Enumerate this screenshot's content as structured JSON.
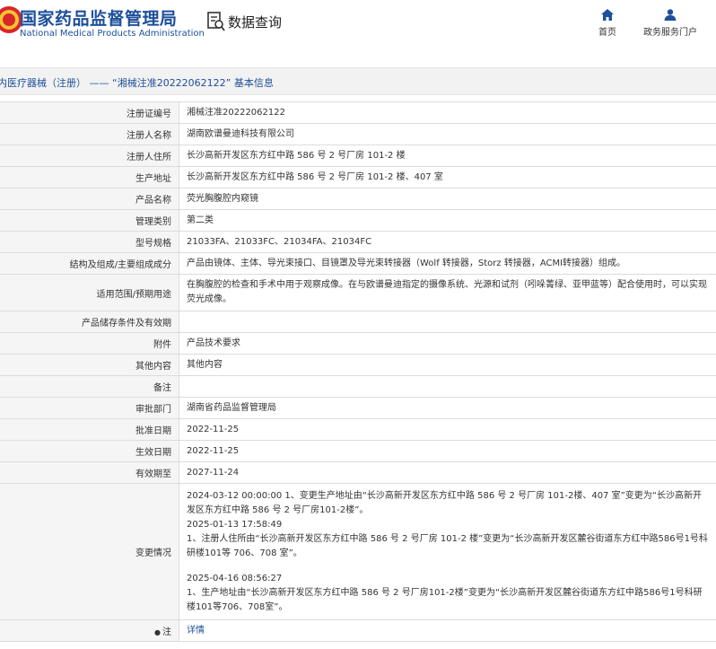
{
  "header": {
    "brand_cn": "国家药品监督管理局",
    "brand_en": "National Medical Products Administration",
    "query_title": "数据查询",
    "nav": [
      {
        "label": "首页",
        "icon": "home-icon"
      },
      {
        "label": "政务服务门户",
        "icon": "user-icon"
      }
    ]
  },
  "breadcrumb": "内医疗器械（注册） —— “湘械注准20222062122” 基本信息",
  "colors": {
    "brand": "#1d4f9b",
    "label_bg": "#f5f5f5",
    "border": "#dcdcdc"
  },
  "rows": [
    {
      "label": "注册证编号",
      "value": "湘械注准20222062122"
    },
    {
      "label": "注册人名称",
      "value": "湖南欧谱曼迪科技有限公司"
    },
    {
      "label": "注册人住所",
      "value": "长沙高新开发区东方红中路 586 号 2 号厂房 101-2 楼"
    },
    {
      "label": "生产地址",
      "value": "长沙高新开发区东方红中路 586 号 2 号厂房 101-2 楼、407 室"
    },
    {
      "label": "产品名称",
      "value": "荧光胸腹腔内窥镜"
    },
    {
      "label": "管理类别",
      "value": "第二类"
    },
    {
      "label": "型号规格",
      "value": "21033FA、21033FC、21034FA、21034FC"
    },
    {
      "label": "结构及组成/主要组成成分",
      "value": "产品由镜体、主体、导光束接口、目镜罩及导光束转接器（Wolf 转接器，Storz 转接器，ACMI转接器）组成。"
    },
    {
      "label": "适用范围/预期用途",
      "value": "在胸腹腔的检查和手术中用于观察成像。在与欧谱曼迪指定的摄像系统、光源和试剂（吲哚菁绿、亚甲蓝等）配合使用时，可以实现荧光成像。"
    },
    {
      "label": "产品储存条件及有效期",
      "value": ""
    },
    {
      "label": "附件",
      "value": "产品技术要求"
    },
    {
      "label": "其他内容",
      "value": "其他内容"
    },
    {
      "label": "备注",
      "value": ""
    },
    {
      "label": "审批部门",
      "value": "湖南省药品监督管理局"
    },
    {
      "label": "批准日期",
      "value": "2022-11-25"
    },
    {
      "label": "生效日期",
      "value": "2022-11-25"
    },
    {
      "label": "有效期至",
      "value": "2027-11-24"
    }
  ],
  "changes": {
    "label": "变更情况",
    "entries": [
      {
        "text": "2024-03-12 00:00:00 1、变更生产地址由“长沙高新开发区东方红中路 586 号 2 号厂房 101-2楼、407 室”变更为“长沙高新开发区东方红中路 586 号 2 号厂房101-2楼”。"
      },
      {
        "time": "2025-01-13 17:58:49",
        "text": "1、注册人住所由“长沙高新开发区东方红中路 586 号 2 号厂房 101-2 楼”变更为“长沙高新开发区麓谷街道东方红中路586号1号科研楼101等 706、708 室”。"
      },
      {
        "time": "2025-04-16 08:56:27",
        "text": "1、生产地址由“长沙高新开发区东方红中路 586 号 2 号厂房101-2楼”变更为“长沙高新开发区麓谷街道东方红中路586号1号科研楼101等706、708室”。"
      }
    ]
  },
  "note_row": {
    "label": "注",
    "link": "详情"
  }
}
